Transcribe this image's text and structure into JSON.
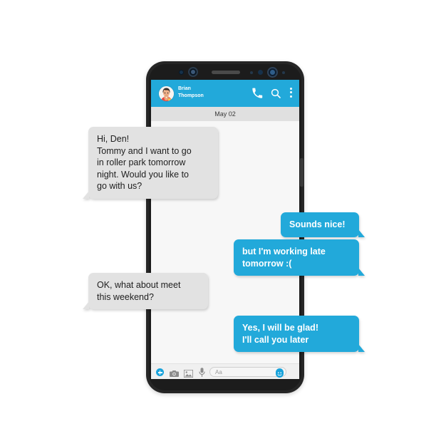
{
  "app": {
    "title": "Messenger chat mockup",
    "accent_color": "#22a9da",
    "incoming_bubble_color": "#e2e2e2",
    "outgoing_bubble_color": "#22a9da",
    "screen_background": "#f7f7f7",
    "page_background": "#ffffff",
    "device_color": "#262626"
  },
  "header": {
    "contact_name": "Brian\nThompson",
    "avatar_icon": "user-avatar",
    "call_icon": "phone-icon",
    "search_icon": "search-icon",
    "menu_icon": "three-dot-menu-icon"
  },
  "conversation": {
    "date_label": "May 02",
    "messages": [
      {
        "direction": "incoming",
        "text": "Hi, Den!\nTommy and I want to go\nin roller park tomorrow\nnight. Would you like to\ngo with us?"
      },
      {
        "direction": "outgoing",
        "text": "Sounds nice!"
      },
      {
        "direction": "outgoing",
        "text": "but I'm working late\ntomorrow :("
      },
      {
        "direction": "incoming",
        "text": "OK, what about meet\nthis weekend?"
      },
      {
        "direction": "outgoing",
        "text": "Yes, I will be glad!\nI'll call you later"
      }
    ]
  },
  "input_bar": {
    "placeholder": "Aa",
    "value": "",
    "add_icon": "plus-circle-icon",
    "camera_icon": "camera-icon",
    "gallery_icon": "photo-image-icon",
    "mic_icon": "microphone-icon",
    "emoji_icon": "smiley-face-icon"
  }
}
